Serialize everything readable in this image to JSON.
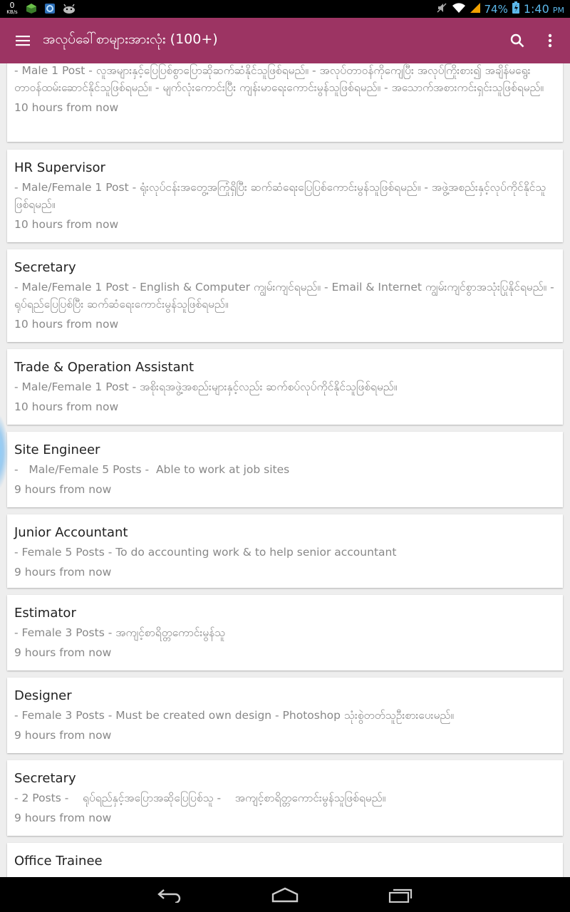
{
  "status_bar": {
    "net_speed_value": "0",
    "net_speed_unit": "KB/s",
    "battery_percent": "74%",
    "time": "1:40",
    "time_suffix": "PM",
    "accent_color": "#5bb7e9"
  },
  "app_bar": {
    "title": "အလုပ်ခေါ်စာများအားလုံး (100+)",
    "color": "#9c3463",
    "icons": [
      "menu-icon",
      "search-icon",
      "more-vert-icon"
    ]
  },
  "jobs": [
    {
      "title": "",
      "desc": "- Male 1 Post - လူအများနှင့်ပြေပြစ်စွာပြောဆိုဆက်ဆံနိုင်သူဖြစ်ရမည်။ -    အလုပ်တာဝန်ကိုကျေပြီး အလုပ်ကြိုးစား၍ အချိန်မရွေးတာဝန်ထမ်းဆောင်နိုင်သူဖြစ်ရမည်။ - မျက်လုံးကောင်းပြီး ကျန်းမာရေးကောင်းမွန်သူဖြစ်ရမည်။ - အသောက်အစားကင်းရှင်းသူဖြစ်ရမည်။",
      "time": "10 hours from now"
    },
    {
      "title": "HR Supervisor",
      "desc": "- Male/Female 1 Post - ရုံးလုပ်ငန်းအတွေ့အကြုံရှိပြီး ဆက်ဆံရေးပြေပြစ်ကောင်းမွန်သူဖြစ်ရမည်။ - အဖွဲ့အစည်းနှင့်လုပ်ကိုင်နိုင်သူဖြစ်ရမည်။",
      "time": "10 hours from now"
    },
    {
      "title": "Secretary",
      "desc": "- Male/Female 1 Post - English & Computer ကျွမ်းကျင်ရမည်။ - Email & Internet ကျွမ်းကျင်စွာအသုံးပြုနိုင်ရမည်။ - ရုပ်ရည်ပြေပြစ်ပြီး ဆက်ဆံရေးကောင်းမွန်သူဖြစ်ရမည်။",
      "time": "10 hours from now"
    },
    {
      "title": "Trade & Operation Assistant",
      "desc": "- Male/Female 1 Post - အစိုးရအဖွဲ့အစည်းများနှင့်လည်း ဆက်စပ်လုပ်ကိုင်နိုင်သူဖြစ်ရမည်။",
      "time": "10 hours from now"
    },
    {
      "title": "Site Engineer",
      "desc": "-   Male/Female 5 Posts -  Able to work at job sites",
      "time": "9 hours from now"
    },
    {
      "title": "Junior Accountant",
      "desc": "- Female 5 Posts - To do accounting work & to help senior accountant",
      "time": "9 hours from now"
    },
    {
      "title": "Estimator",
      "desc": "- Female 3 Posts - အကျင့်စာရိတ္တကောင်းမွန်သူ",
      "time": "9 hours from now"
    },
    {
      "title": "Designer",
      "desc": "- Female 3 Posts - Must be created own design -  Photoshop သုံးစွဲတတ်သူဦးစားပေးမည်။",
      "time": "9 hours from now"
    },
    {
      "title": "Secretary",
      "desc": "- 2 Posts -    ရုပ်ရည်နှင့်အပြောအဆိုပြေပြစ်သူ -    အကျင့်စာရိတ္တကောင်းမွန်သူဖြစ်ရမည်။",
      "time": "9 hours from now"
    },
    {
      "title": "Office Trainee",
      "desc": "",
      "time": ""
    }
  ],
  "nav_bar": {
    "icons": [
      "back-icon",
      "home-icon",
      "recents-icon"
    ]
  }
}
